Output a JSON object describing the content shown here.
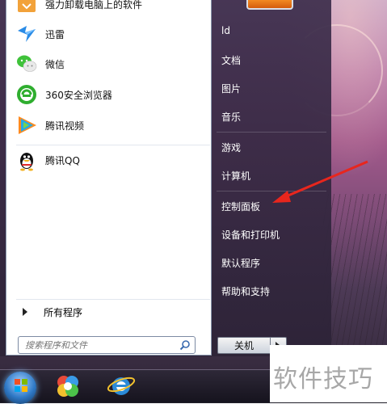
{
  "start_menu": {
    "programs": [
      {
        "label": "强力卸载电脑上的软件",
        "icon": "uninstaller-icon"
      },
      {
        "label": "迅雷",
        "icon": "xunlei-icon"
      },
      {
        "label": "微信",
        "icon": "wechat-icon"
      },
      {
        "label": "360安全浏览器",
        "icon": "360-browser-icon"
      },
      {
        "label": "腾讯视频",
        "icon": "tencent-video-icon"
      },
      {
        "label": "腾讯QQ",
        "icon": "qq-penguin-icon"
      }
    ],
    "all_programs_label": "所有程序",
    "search": {
      "placeholder": "搜索程序和文件"
    },
    "right_items": [
      {
        "label": "ld"
      },
      {
        "label": "文档"
      },
      {
        "label": "图片"
      },
      {
        "label": "音乐"
      },
      {
        "label": "游戏"
      },
      {
        "label": "计算机"
      },
      {
        "label": "控制面板"
      },
      {
        "label": "设备和打印机"
      },
      {
        "label": "默认程序"
      },
      {
        "label": "帮助和支持"
      }
    ],
    "shutdown_label": "关机"
  },
  "watermark": {
    "text": "软件技巧"
  },
  "colors": {
    "annotation_arrow": "#e8261d",
    "start_orb": "#2f79c6"
  }
}
